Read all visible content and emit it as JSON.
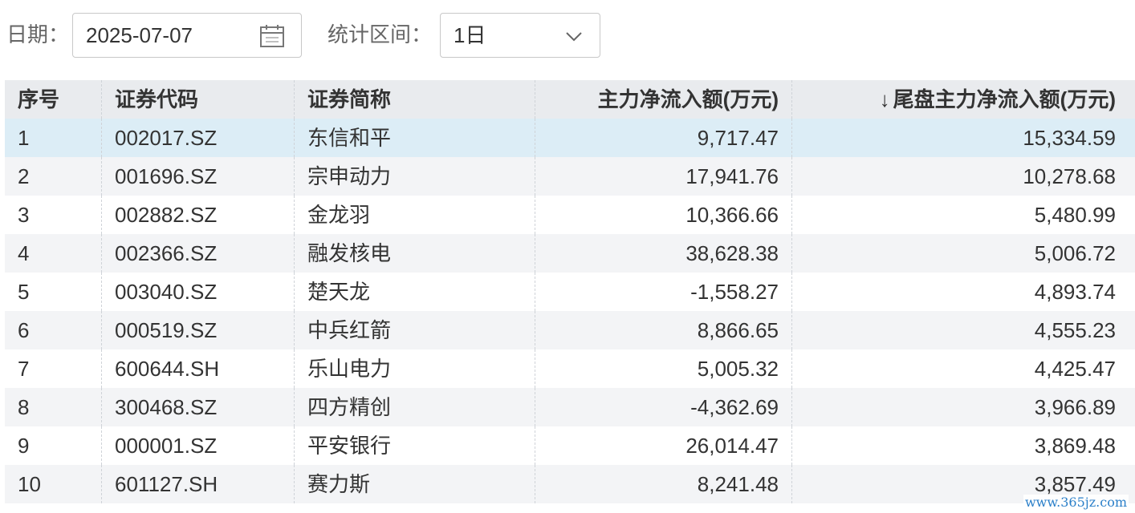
{
  "filters": {
    "date_label": "日期：",
    "date_value": "2025-07-07",
    "range_label": "统计区间：",
    "range_value": "1日",
    "date_icon": "calendar-icon",
    "range_icon": "chevron-down-icon"
  },
  "table": {
    "sort_indicator": "↓",
    "columns": [
      "序号",
      "证券代码",
      "证券简称",
      "主力净流入额(万元)",
      "尾盘主力净流入额(万元)"
    ],
    "rows": [
      {
        "no": "1",
        "code": "002017.SZ",
        "name": "东信和平",
        "net_inflow": "9,717.47",
        "tail_inflow": "15,334.59"
      },
      {
        "no": "2",
        "code": "001696.SZ",
        "name": "宗申动力",
        "net_inflow": "17,941.76",
        "tail_inflow": "10,278.68"
      },
      {
        "no": "3",
        "code": "002882.SZ",
        "name": "金龙羽",
        "net_inflow": "10,366.66",
        "tail_inflow": "5,480.99"
      },
      {
        "no": "4",
        "code": "002366.SZ",
        "name": "融发核电",
        "net_inflow": "38,628.38",
        "tail_inflow": "5,006.72"
      },
      {
        "no": "5",
        "code": "003040.SZ",
        "name": "楚天龙",
        "net_inflow": "-1,558.27",
        "tail_inflow": "4,893.74"
      },
      {
        "no": "6",
        "code": "000519.SZ",
        "name": "中兵红箭",
        "net_inflow": "8,866.65",
        "tail_inflow": "4,555.23"
      },
      {
        "no": "7",
        "code": "600644.SH",
        "name": "乐山电力",
        "net_inflow": "5,005.32",
        "tail_inflow": "4,425.47"
      },
      {
        "no": "8",
        "code": "300468.SZ",
        "name": "四方精创",
        "net_inflow": "-4,362.69",
        "tail_inflow": "3,966.89"
      },
      {
        "no": "9",
        "code": "000001.SZ",
        "name": "平安银行",
        "net_inflow": "26,014.47",
        "tail_inflow": "3,869.48"
      },
      {
        "no": "10",
        "code": "601127.SH",
        "name": "赛力斯",
        "net_inflow": "8,241.48",
        "tail_inflow": "3,857.49"
      }
    ]
  },
  "watermark": "www.365jz.com",
  "colors": {
    "header_bg": "#e9ebee",
    "highlight_row": "#dcedf6",
    "stripe_row": "#f3f4f6",
    "watermark": "#2a7fc9"
  }
}
